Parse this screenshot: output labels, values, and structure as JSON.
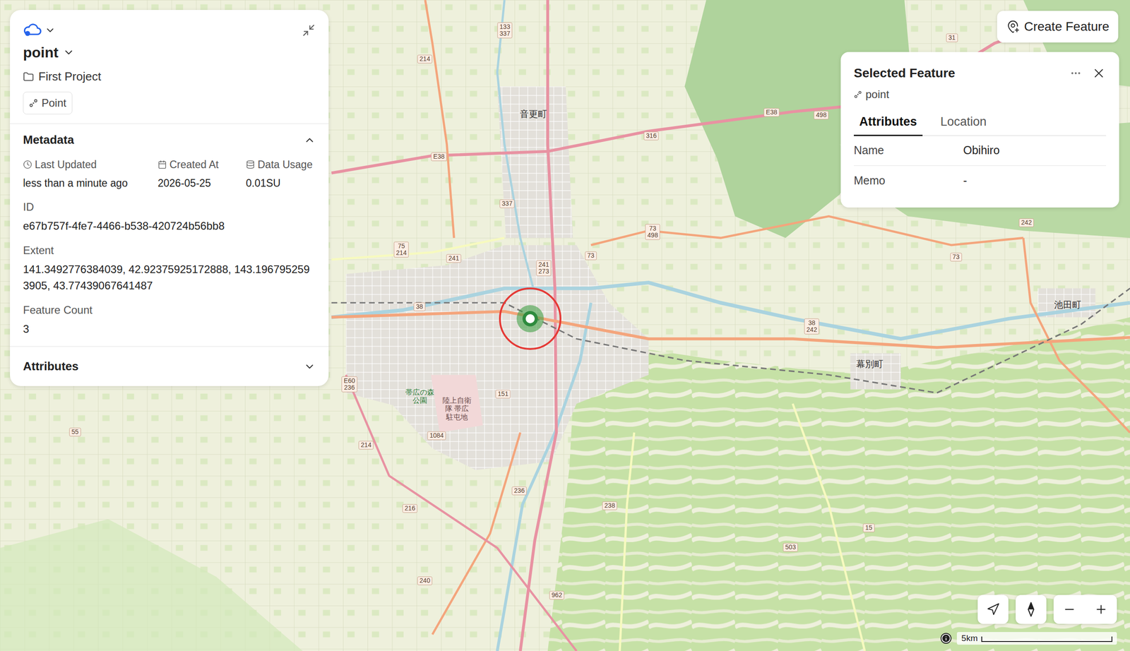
{
  "layer": {
    "title": "point",
    "project": "First Project",
    "geometry_type": "Point"
  },
  "metadata": {
    "title": "Metadata",
    "expanded": true,
    "fields": [
      {
        "label": "Last Updated",
        "value": "less than a minute ago"
      },
      {
        "label": "Created At",
        "value": "2026-05-25"
      },
      {
        "label": "Data Usage",
        "value": "0.01SU"
      }
    ],
    "id": {
      "label": "ID",
      "value": "e67b757f-4fe7-4466-b538-420724b56bb8"
    },
    "extent": {
      "label": "Extent",
      "value": "141.3492776384039, 42.92375925172888, 143.1967952593905, 43.77439067641487"
    },
    "feature_count": {
      "label": "Feature Count",
      "value": "3"
    }
  },
  "attributes_section": {
    "title": "Attributes",
    "expanded": false
  },
  "toolbar": {
    "create_feature": "Create Feature"
  },
  "selected_feature": {
    "title": "Selected Feature",
    "layer": "point",
    "tabs": [
      {
        "label": "Attributes",
        "selected": true
      },
      {
        "label": "Location",
        "selected": false
      }
    ],
    "rows": [
      {
        "label": "Name",
        "value": "Obihiro"
      },
      {
        "label": "Memo",
        "value": "-"
      }
    ]
  },
  "map": {
    "scale": "5km",
    "selected_marker": {
      "selected": true
    },
    "places": [
      {
        "name": "音更町",
        "kind": "town"
      },
      {
        "name": "池田町",
        "kind": "town"
      },
      {
        "name": "幕別町",
        "kind": "town"
      },
      {
        "name": "帯広の森公園",
        "kind": "park"
      },
      {
        "name": "陸上自衛隊 帯広駐屯地",
        "kind": "military"
      }
    ],
    "road_shields": [
      {
        "lines": [
          "38"
        ]
      },
      {
        "lines": [
          "241"
        ]
      },
      {
        "lines": [
          "241",
          "273"
        ]
      },
      {
        "lines": [
          "337"
        ]
      },
      {
        "lines": [
          "316"
        ]
      },
      {
        "lines": [
          "E38"
        ]
      },
      {
        "lines": [
          "498"
        ]
      },
      {
        "lines": [
          "73"
        ]
      },
      {
        "lines": [
          "73",
          "498"
        ]
      },
      {
        "lines": [
          "75",
          "214"
        ]
      },
      {
        "lines": [
          "214"
        ]
      },
      {
        "lines": [
          "133",
          "337"
        ]
      },
      {
        "lines": [
          "E38"
        ]
      },
      {
        "lines": [
          "31"
        ]
      },
      {
        "lines": [
          "242"
        ]
      },
      {
        "lines": [
          "73"
        ]
      },
      {
        "lines": [
          "38",
          "242"
        ]
      },
      {
        "lines": [
          "E60",
          "236"
        ]
      },
      {
        "lines": [
          "151"
        ]
      },
      {
        "lines": [
          "1084"
        ]
      },
      {
        "lines": [
          "214"
        ]
      },
      {
        "lines": [
          "236"
        ]
      },
      {
        "lines": [
          "216"
        ]
      },
      {
        "lines": [
          "238"
        ]
      },
      {
        "lines": [
          "240"
        ]
      },
      {
        "lines": [
          "962"
        ]
      },
      {
        "lines": [
          "503"
        ]
      },
      {
        "lines": [
          "15"
        ]
      },
      {
        "lines": [
          "55"
        ]
      }
    ]
  }
}
